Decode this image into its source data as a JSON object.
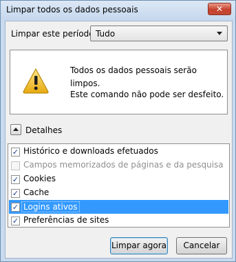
{
  "window": {
    "title": "Limpar todos os dados pessoais",
    "close_symbol": "✕"
  },
  "period": {
    "label": "Limpar este período:",
    "selected": "Tudo"
  },
  "warning": {
    "icon": "warning-icon",
    "line1": "Todos os dados pessoais serão limpos.",
    "line2": "Este comando não pode ser desfeito."
  },
  "details": {
    "label": "Detalhes",
    "items": [
      {
        "label": "Histórico e downloads efetuados",
        "checked": true,
        "enabled": true,
        "selected": false
      },
      {
        "label": "Campos memorizados de páginas e da pesquisa",
        "checked": false,
        "enabled": false,
        "selected": false
      },
      {
        "label": "Cookies",
        "checked": true,
        "enabled": true,
        "selected": false
      },
      {
        "label": "Cache",
        "checked": true,
        "enabled": true,
        "selected": false
      },
      {
        "label": "Logins ativos",
        "checked": true,
        "enabled": true,
        "selected": true
      },
      {
        "label": "Preferências de sites",
        "checked": true,
        "enabled": true,
        "selected": false
      }
    ]
  },
  "buttons": {
    "ok": "Limpar agora",
    "cancel": "Cancelar"
  },
  "colors": {
    "selection": "#3399ff",
    "close_button": "#c7422d",
    "warning_yellow": "#f2c21a"
  }
}
